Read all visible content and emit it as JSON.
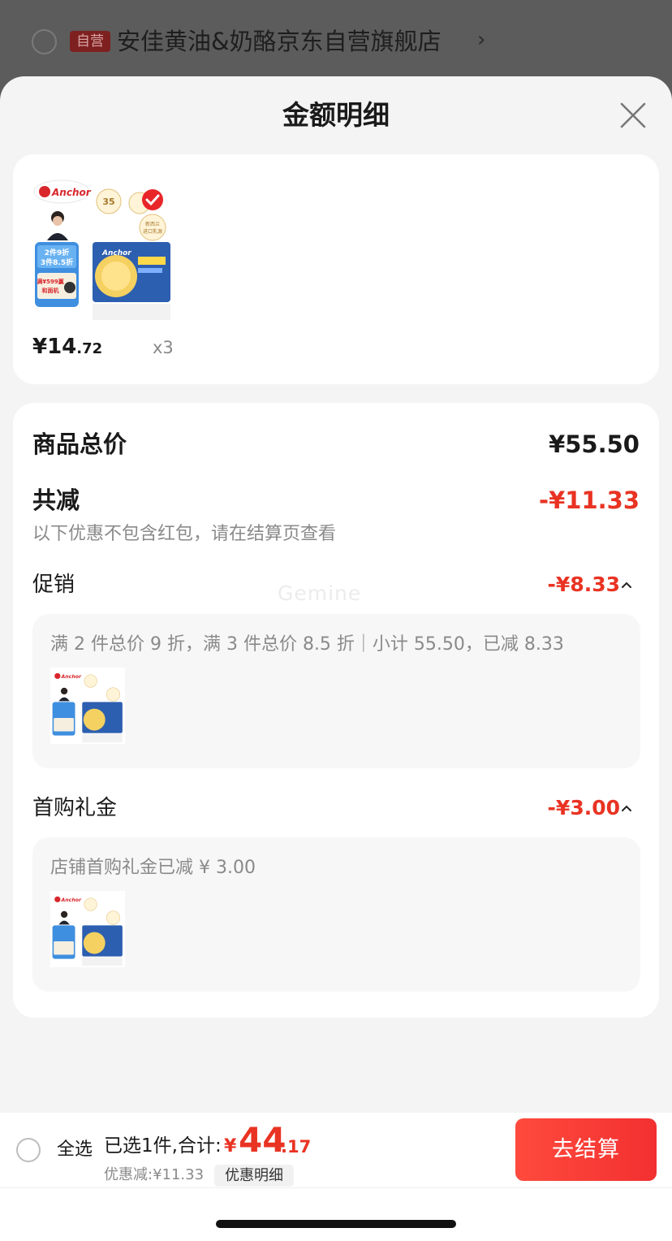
{
  "background_store": {
    "badge": "自营",
    "name": "安佳黄油&奶酪京东自营旗舰店",
    "arrow": "›"
  },
  "sheet": {
    "title": "金额明细"
  },
  "product": {
    "brand": "Anchor",
    "price_int": "¥14",
    "price_dec": ".72",
    "quantity": "x3",
    "promo_tag": "2件9折 3件8.5折",
    "gift_tag": "满¥599赢 和面机",
    "badge_35": "35",
    "badge_origin": "新西兰 进口乳源"
  },
  "summary": {
    "total_label": "商品总价",
    "total_value": "¥55.50",
    "reduce_label": "共减",
    "reduce_value": "-¥11.33",
    "note": "以下优惠不包含红包，请在结算页查看"
  },
  "promotion": {
    "label": "促销",
    "value": "-¥8.33",
    "detail": "满 2 件总价 9 折，满 3 件总价 8.5 折｜小计 55.50，已减 8.33"
  },
  "first_gift": {
    "label": "首购礼金",
    "value": "-¥3.00",
    "detail": "店铺首购礼金已减 ¥ 3.00"
  },
  "watermark": "Gemine",
  "bottom": {
    "select_all": "全选",
    "selected": "已选1件,合计:",
    "total_symbol": "¥",
    "total_int": "44",
    "total_dec": ".17",
    "discount": "优惠减:¥11.33",
    "discount_link": "优惠明细",
    "checkout": "去结算"
  },
  "colors": {
    "accent_red": "#e93323",
    "checkout_button": "#f23030"
  }
}
